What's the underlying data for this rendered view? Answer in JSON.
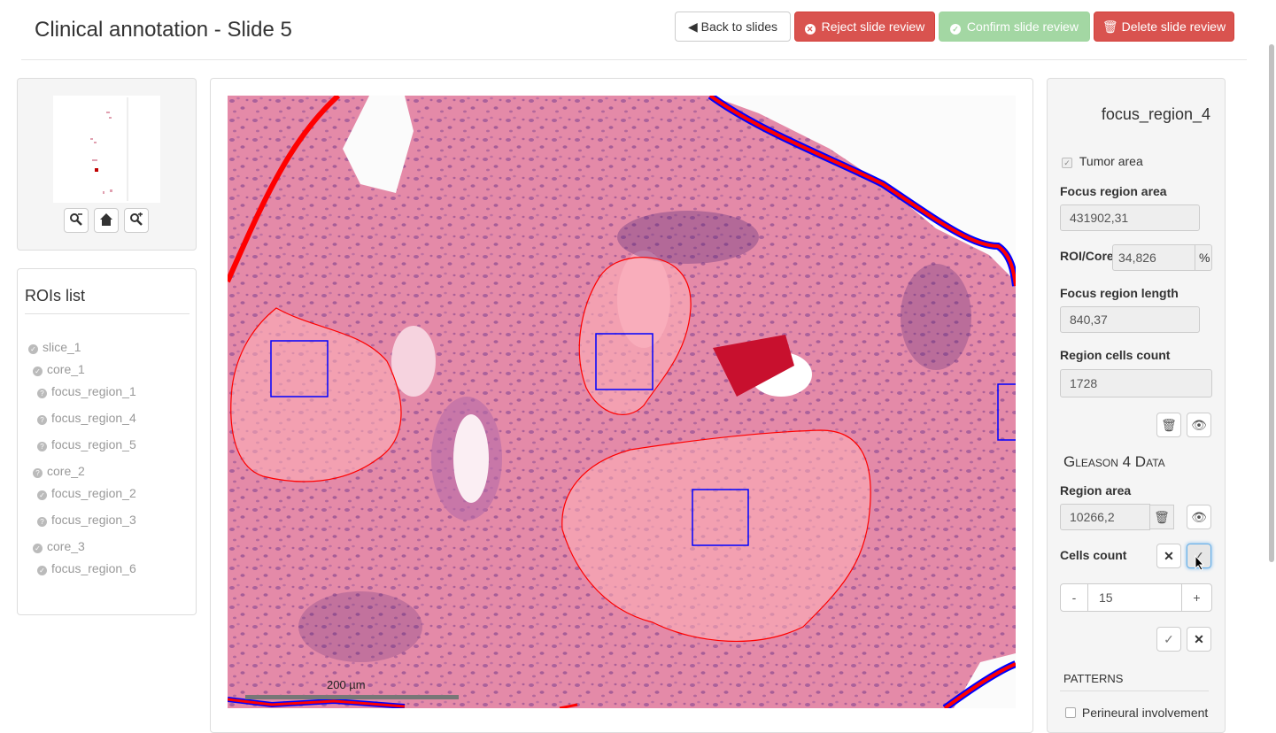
{
  "header": {
    "title": "Clinical annotation - Slide 5",
    "buttons": {
      "back": "Back to slides",
      "reject": "Reject slide review",
      "confirm": "Confirm slide review",
      "delete": "Delete slide review"
    }
  },
  "navigator": {
    "zoom_out_icon": "zoom-out-icon",
    "home_icon": "home-icon",
    "zoom_in_icon": "zoom-in-icon"
  },
  "rois": {
    "title": "ROIs list",
    "items": [
      {
        "label": "slice_1",
        "status": "done"
      },
      {
        "label": "core_1",
        "status": "done"
      },
      {
        "label": "focus_region_1",
        "status": "pending"
      },
      {
        "label": "focus_region_4",
        "status": "pending"
      },
      {
        "label": "focus_region_5",
        "status": "pending"
      },
      {
        "label": "core_2",
        "status": "pending"
      },
      {
        "label": "focus_region_2",
        "status": "done"
      },
      {
        "label": "focus_region_3",
        "status": "pending"
      },
      {
        "label": "core_3",
        "status": "done"
      },
      {
        "label": "focus_region_6",
        "status": "done"
      }
    ]
  },
  "viewer": {
    "scale_label": "200 µm"
  },
  "details": {
    "title": "focus_region_4",
    "tumor_area_label": "Tumor area",
    "tumor_area_checked": true,
    "focus_region_area_label": "Focus region area",
    "focus_region_area_value": "431902,31",
    "roi_core_label": "ROI/Core",
    "roi_core_value": "34,826",
    "roi_core_unit": "%",
    "focus_region_length_label": "Focus region length",
    "focus_region_length_value": "840,37",
    "region_cells_count_label": "Region cells count",
    "region_cells_count_value": "1728",
    "gleason_title": "Gleason 4 Data",
    "region_area_label": "Region area",
    "region_area_value": "10266,2",
    "cells_count_label": "Cells count",
    "stepper_minus": "-",
    "stepper_value": "15",
    "stepper_plus": "+",
    "patterns_label": "PATTERNS",
    "perineural_label": "Perineural involvement"
  },
  "colors": {
    "danger": "#d9534f",
    "success_disabled": "#a3d7a3",
    "annotation_red": "#ff0000",
    "annotation_blue": "#0000ff",
    "tissue_pink": "#e48aa8"
  }
}
